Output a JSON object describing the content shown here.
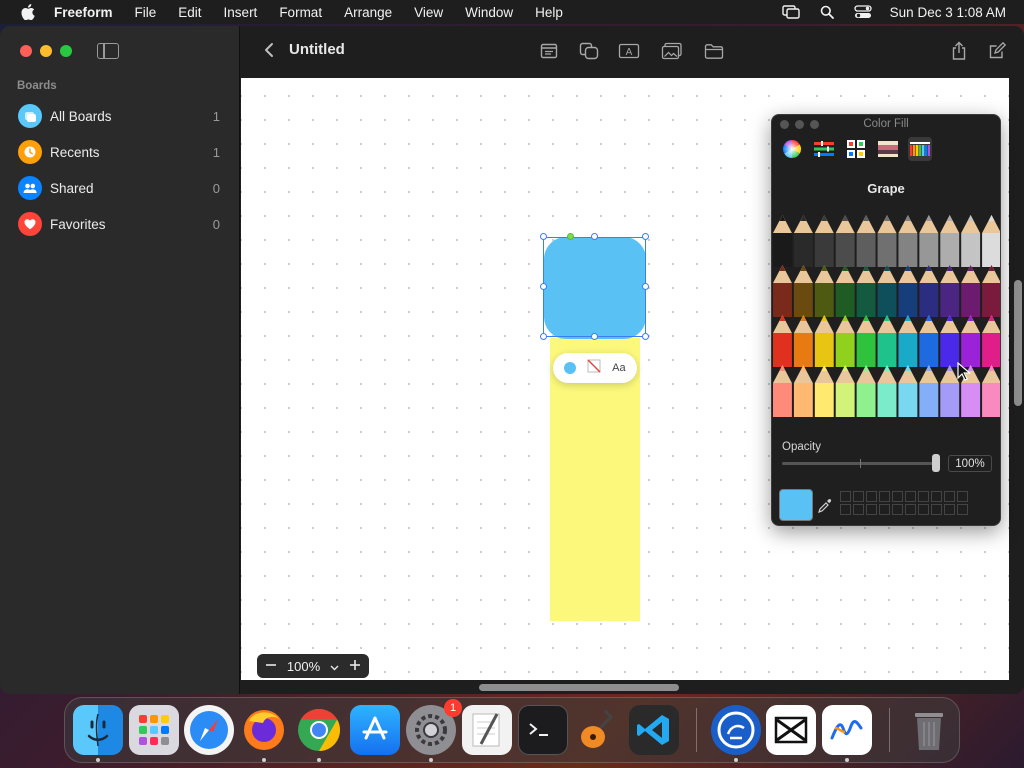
{
  "menubar": {
    "app_name": "Freeform",
    "menus": [
      "File",
      "Edit",
      "Insert",
      "Format",
      "Arrange",
      "View",
      "Window",
      "Help"
    ],
    "clock": "Sun Dec 3  1:08 AM"
  },
  "sidebar": {
    "section_title": "Boards",
    "items": [
      {
        "label": "All Boards",
        "count": "1",
        "icon": "boards-icon",
        "color": "#5ac8fa"
      },
      {
        "label": "Recents",
        "count": "1",
        "icon": "clock-icon",
        "color": "#ff9f0a"
      },
      {
        "label": "Shared",
        "count": "0",
        "icon": "people-icon",
        "color": "#0a84ff"
      },
      {
        "label": "Favorites",
        "count": "0",
        "icon": "heart-icon",
        "color": "#ff453a"
      }
    ]
  },
  "toolbar": {
    "title": "Untitled",
    "tools": [
      "sticky-note-icon",
      "shapes-icon",
      "text-box-icon",
      "media-icon",
      "files-icon"
    ],
    "share": "share-icon",
    "compose": "compose-icon"
  },
  "canvas": {
    "shape_color": "#5ac1f5",
    "sticky_color": "#fbf87c",
    "mini_bar_text": "Aa",
    "zoom_level": "100%"
  },
  "palette": {
    "title": "Color Fill",
    "mode_icons": [
      "color-wheel-icon",
      "sliders-icon",
      "color-palettes-icon",
      "image-palette-icon",
      "pencils-icon"
    ],
    "selected_color_name": "Grape",
    "opacity_label": "Opacity",
    "opacity_value": "100%",
    "current_color": "#5ac1f5"
  },
  "dock": {
    "apps": [
      "Finder",
      "Launchpad",
      "Safari",
      "Firefox",
      "Chrome",
      "App Store",
      "System Settings",
      "Script Editor",
      "Terminal",
      "GarageBand",
      "Visual Studio Code",
      "Screen Sharing",
      "CapCut",
      "Freeform",
      "Trash"
    ],
    "settings_badge": "1"
  }
}
